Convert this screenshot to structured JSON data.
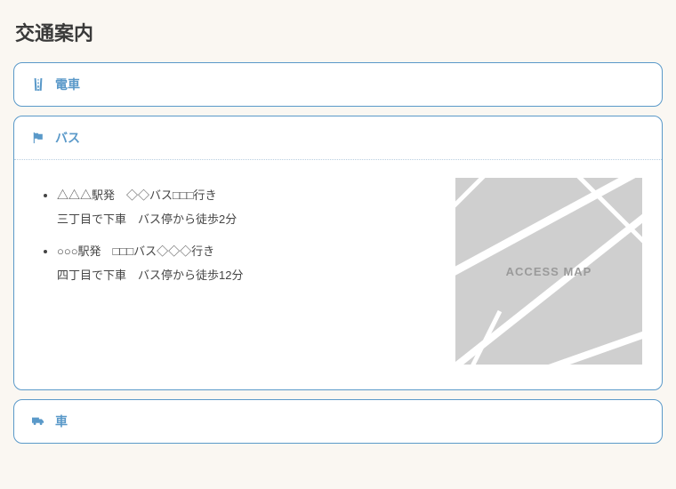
{
  "title": "交通案内",
  "sections": {
    "train": {
      "label": "電車"
    },
    "bus": {
      "label": "バス",
      "items": [
        {
          "line1": "△△△駅発　◇◇バス□□□行き",
          "line2": "三丁目で下車　バス停から徒歩2分"
        },
        {
          "line1": "○○○駅発　□□□バス◇◇◇行き",
          "line2": "四丁目で下車　バス停から徒歩12分"
        }
      ],
      "map_label": "ACCESS MAP"
    },
    "car": {
      "label": "車"
    }
  }
}
